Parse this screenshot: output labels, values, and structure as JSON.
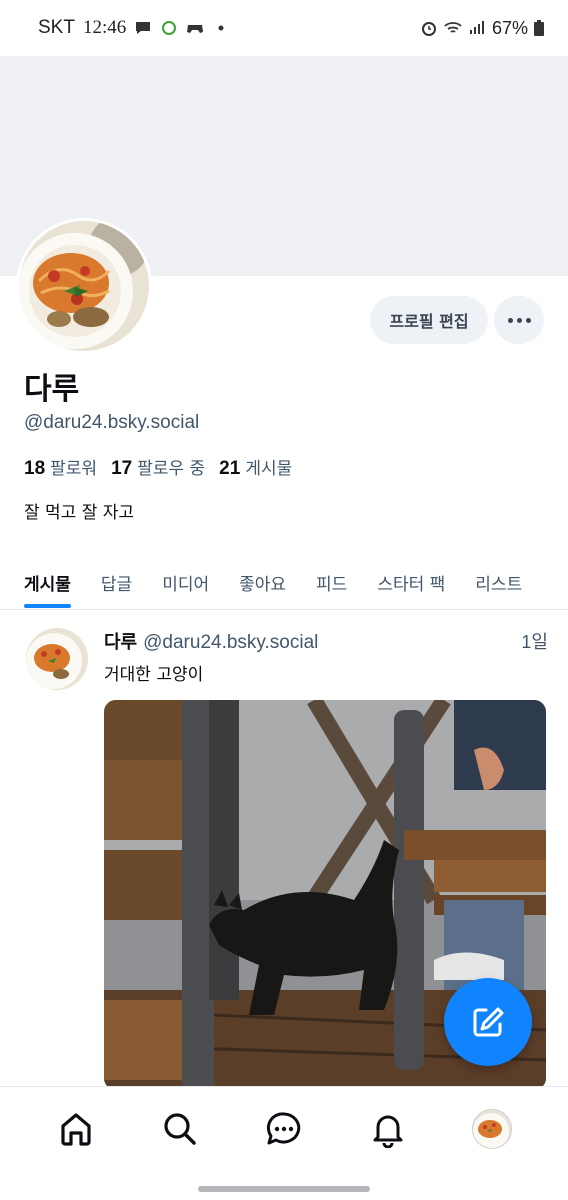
{
  "status_bar": {
    "carrier": "SKT",
    "time": "12:46",
    "battery": "67%"
  },
  "profile": {
    "display_name": "다루",
    "handle": "@daru24.bsky.social",
    "followers_count": "18",
    "followers_label": "팔로워",
    "following_count": "17",
    "following_label": "팔로우 중",
    "posts_count": "21",
    "posts_label": "게시물",
    "bio": "잘 먹고 잘 자고",
    "edit_button_label": "프로필 편집"
  },
  "tabs": [
    {
      "label": "게시물",
      "active": true
    },
    {
      "label": "답글",
      "active": false
    },
    {
      "label": "미디어",
      "active": false
    },
    {
      "label": "좋아요",
      "active": false
    },
    {
      "label": "피드",
      "active": false
    },
    {
      "label": "스타터 팩",
      "active": false
    },
    {
      "label": "리스트",
      "active": false
    }
  ],
  "post": {
    "author_name": "다루",
    "author_handle": "@daru24.bsky.social",
    "time": "1일",
    "text": "거대한 고양이"
  },
  "bottom_nav": {
    "items": [
      "home-icon",
      "search-icon",
      "chat-icon",
      "bell-icon",
      "profile-avatar"
    ]
  },
  "colors": {
    "accent": "#1083fe",
    "muted_text": "#42576c",
    "button_bg": "#eef1f5",
    "banner": "#eef0f3"
  }
}
